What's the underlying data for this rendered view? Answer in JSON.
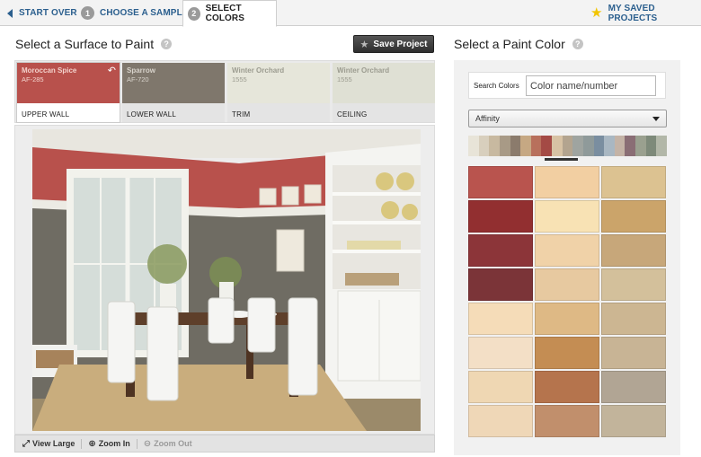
{
  "nav": {
    "start_over": "START OVER",
    "step1_num": "1",
    "step1_label": "CHOOSE A SAMPLE",
    "step2_num": "2",
    "step2_label": "SELECT COLORS",
    "saved": "MY SAVED PROJECTS"
  },
  "left": {
    "title": "Select a Surface to Paint",
    "save_label": "Save Project",
    "surfaces": [
      {
        "name": "Moroccan Spice",
        "code": "AF-285",
        "label": "UPPER WALL",
        "color": "#b8514c",
        "text_color": "#f3d2cc"
      },
      {
        "name": "Sparrow",
        "code": "AF-720",
        "label": "LOWER WALL",
        "color": "#7f776c",
        "text_color": "#d8d3cb"
      },
      {
        "name": "Winter Orchard",
        "code": "1555",
        "label": "TRIM",
        "color": "#e6e6da",
        "text_color": "#9c9c90"
      },
      {
        "name": "Winter Orchard",
        "code": "1555",
        "label": "CEILING",
        "color": "#dfe0d4",
        "text_color": "#9c9c90"
      }
    ],
    "tools": {
      "view_large": "View Large",
      "zoom_in": "Zoom In",
      "zoom_out": "Zoom Out"
    }
  },
  "right": {
    "title": "Select a Paint Color",
    "search_label": "Search Colors",
    "search_placeholder": "Color name/number",
    "collection": "Affinity",
    "strip_colors": [
      "#e8e4d8",
      "#d8cfbd",
      "#c8b9a0",
      "#a89a86",
      "#8b7b6c",
      "#c6a883",
      "#b8705c",
      "#a44a45",
      "#d7c2a4",
      "#b3a48f",
      "#9fa4a0",
      "#8f9a9a",
      "#7a8ea0",
      "#a9b7c2",
      "#c4b3a6",
      "#8a6e75",
      "#9aa08f",
      "#7e8a7a",
      "#b2b7a8"
    ],
    "swatches": [
      "#b9544e",
      "#f2cfa2",
      "#dcc291",
      "#922f30",
      "#f8e2b4",
      "#cba46a",
      "#8c3539",
      "#f0d2a8",
      "#c7a77a",
      "#7b3438",
      "#e7c9a0",
      "#d3c09b",
      "#f5dcb8",
      "#deb985",
      "#ccb692",
      "#f3dfc6",
      "#c48d53",
      "#c8b495",
      "#efd7b3",
      "#b5744d",
      "#b1a594",
      "#efd7b7",
      "#c18f6c",
      "#c2b49b"
    ]
  }
}
